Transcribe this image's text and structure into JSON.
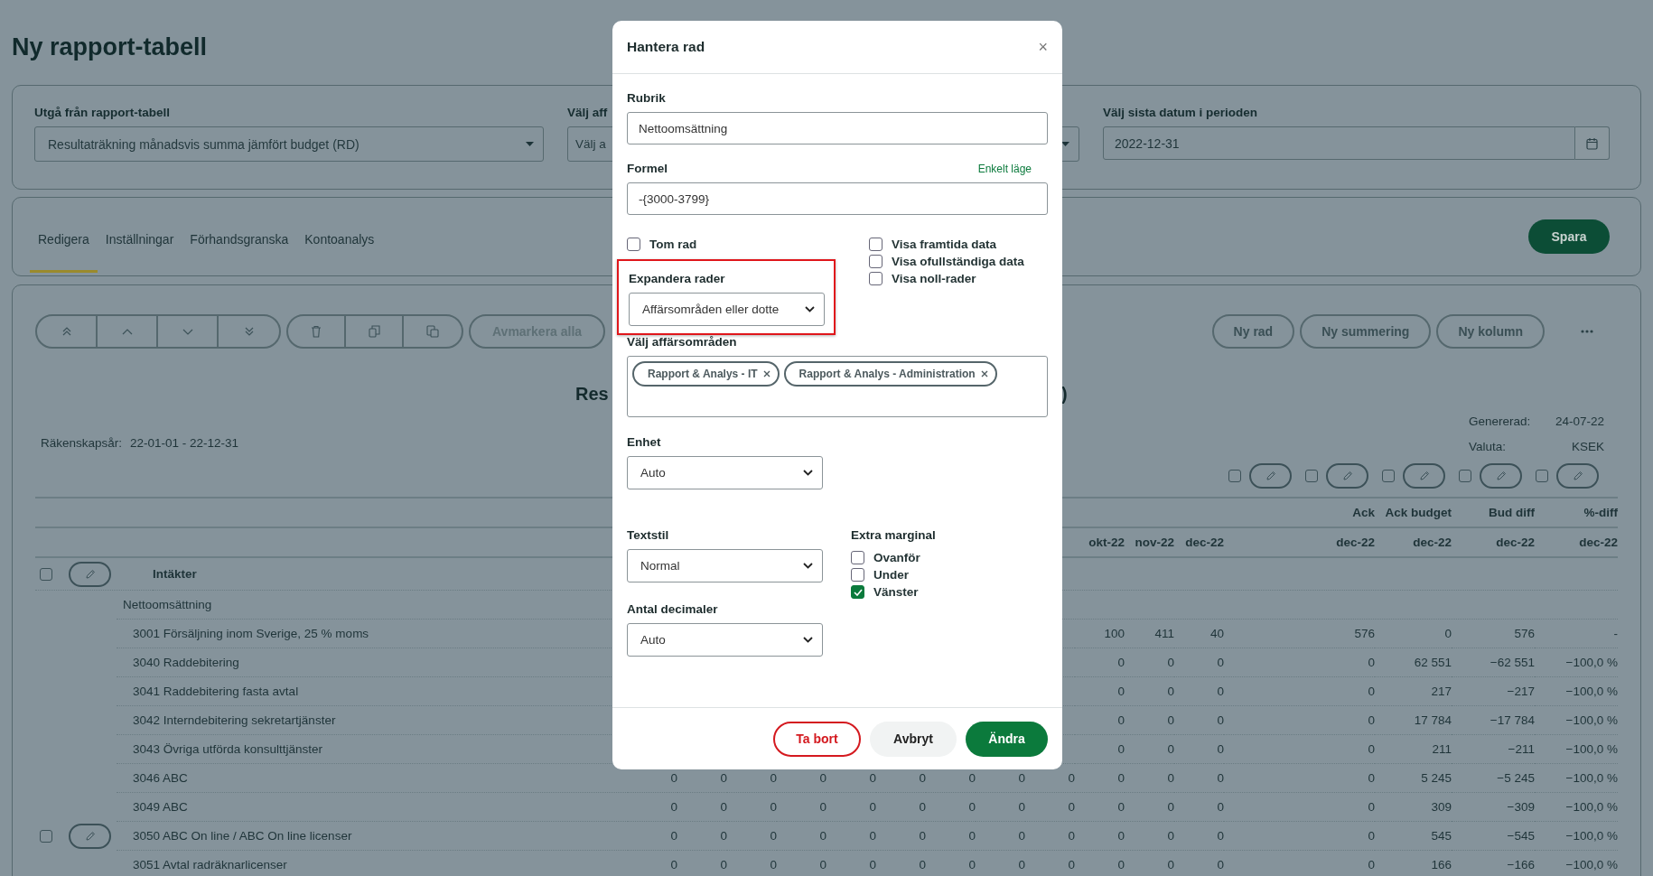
{
  "page": {
    "title": "Ny rapport-tabell"
  },
  "filters": [
    {
      "label": "Utgå från rapport-tabell",
      "value": "Resultaträkning månadsvis summa jämfört budget (RD)",
      "kind": "select"
    },
    {
      "label": "Välj aff",
      "value": "Välj a",
      "kind": "select"
    },
    {
      "label": "Välj sista datum i perioden",
      "value": "2022-12-31",
      "kind": "date"
    }
  ],
  "tabs": [
    {
      "label": "Redigera",
      "selected": true
    },
    {
      "label": "Inställningar",
      "selected": false
    },
    {
      "label": "Förhandsgranska",
      "selected": false
    },
    {
      "label": "Kontoanalys",
      "selected": false
    }
  ],
  "save_button": "Spara",
  "toolbar": {
    "deselect_all": "Avmarkera alla",
    "actions": [
      "Ny rad",
      "Ny summering",
      "Ny kolumn"
    ]
  },
  "report": {
    "title_parts": [
      "Res",
      ")"
    ],
    "generated_label": "Genererad:",
    "generated": "24-07-22",
    "currency_label": "Valuta:",
    "currency": "KSEK",
    "fiscal_label": "Räkenskapsår:",
    "fiscal": "22-01-01 - 22-12-31"
  },
  "column_controls": [
    {
      "checked": false
    },
    {
      "checked": false
    },
    {
      "checked": false
    },
    {
      "checked": false
    },
    {
      "checked": false
    }
  ],
  "table": {
    "summary_top": [
      "Ack",
      "Ack budget",
      "Bud diff",
      "%-diff"
    ],
    "month_headers": [
      "okt-22",
      "nov-22",
      "dec-22"
    ],
    "summary_headers": [
      "dec-22",
      "dec-22",
      "dec-22",
      "dec-22"
    ],
    "rows": [
      {
        "kind": "group",
        "label": "Intäkter",
        "checked": false
      },
      {
        "kind": "subheading",
        "label": "Nettoomsättning"
      },
      {
        "kind": "account",
        "label": "3001 Försäljning inom Sverige, 25 % moms",
        "months": [
          "100",
          "411",
          "40"
        ],
        "summary": [
          "576",
          "0",
          "576",
          "-"
        ]
      },
      {
        "kind": "account",
        "label": "3040 Raddebitering",
        "months": [
          "0",
          "0",
          "0"
        ],
        "summary": [
          "0",
          "62 551",
          "−62 551",
          "−100,0 %"
        ]
      },
      {
        "kind": "account",
        "label": "3041 Raddebitering fasta avtal",
        "months": [
          "0",
          "0",
          "0"
        ],
        "summary": [
          "0",
          "217",
          "−217",
          "−100,0 %"
        ]
      },
      {
        "kind": "account",
        "label": "3042 Interndebitering sekretartjänster",
        "months": [
          "0",
          "0",
          "0"
        ],
        "summary": [
          "0",
          "17 784",
          "−17 784",
          "−100,0 %"
        ]
      },
      {
        "kind": "account",
        "label": "3043 Övriga utförda konsulttjänster",
        "months": [
          "0",
          "0",
          "0"
        ],
        "summary": [
          "0",
          "211",
          "−211",
          "−100,0 %"
        ]
      },
      {
        "kind": "account",
        "label": "3046 ABC",
        "months": [
          "0",
          "0",
          "0",
          "0",
          "0",
          "0",
          "0",
          "0",
          "0",
          "0",
          "0",
          "0"
        ],
        "summary": [
          "0",
          "5 245",
          "−5 245",
          "−100,0 %"
        ]
      },
      {
        "kind": "account",
        "label": "3049 ABC",
        "months": [
          "0",
          "0",
          "0",
          "0",
          "0",
          "0",
          "0",
          "0",
          "0",
          "0",
          "0",
          "0"
        ],
        "summary": [
          "0",
          "309",
          "−309",
          "−100,0 %"
        ]
      },
      {
        "kind": "account",
        "label": "3050 ABC On line / ABC On line licenser",
        "checked": false,
        "months": [
          "0",
          "0",
          "0",
          "0",
          "0",
          "0",
          "0",
          "0",
          "0",
          "0",
          "0",
          "0"
        ],
        "summary": [
          "0",
          "545",
          "−545",
          "−100,0 %"
        ]
      },
      {
        "kind": "account",
        "label": "3051 Avtal radräknarlicenser",
        "months": [
          "0",
          "0",
          "0",
          "0",
          "0",
          "0",
          "0",
          "0",
          "0",
          "0",
          "0",
          "0"
        ],
        "summary": [
          "0",
          "166",
          "−166",
          "−100,0 %"
        ]
      }
    ]
  },
  "dialog": {
    "title": "Hantera rad",
    "close": "×",
    "heading": {
      "label": "Rubrik",
      "value": "Nettoomsättning"
    },
    "formula": {
      "label": "Formel",
      "link": "Enkelt läge",
      "value": "-{3000-3799}"
    },
    "empty_row": {
      "label": "Tom rad",
      "checked": false
    },
    "show_options": [
      {
        "label": "Visa framtida data",
        "checked": false
      },
      {
        "label": "Visa ofullständiga data",
        "checked": false
      },
      {
        "label": "Visa noll-rader",
        "checked": false
      }
    ],
    "expand": {
      "label": "Expandera rader",
      "value": "Affärsområden eller dotte",
      "highlighted": true
    },
    "areas": {
      "label": "Välj affärsområden",
      "tags": [
        "Rapport & Analys - IT",
        "Rapport & Analys - Administration"
      ]
    },
    "unit": {
      "label": "Enhet",
      "value": "Auto"
    },
    "text_style": {
      "label": "Textstil",
      "value": "Normal"
    },
    "decimals": {
      "label": "Antal decimaler",
      "value": "Auto"
    },
    "margin": {
      "label": "Extra marginal",
      "options": [
        {
          "label": "Ovanför",
          "checked": false
        },
        {
          "label": "Under",
          "checked": false
        },
        {
          "label": "Vänster",
          "checked": true
        }
      ]
    },
    "buttons": [
      {
        "label": "Ta bort",
        "kind": "danger"
      },
      {
        "label": "Avbryt",
        "kind": "secondary"
      },
      {
        "label": "Ändra",
        "kind": "primary"
      }
    ]
  }
}
